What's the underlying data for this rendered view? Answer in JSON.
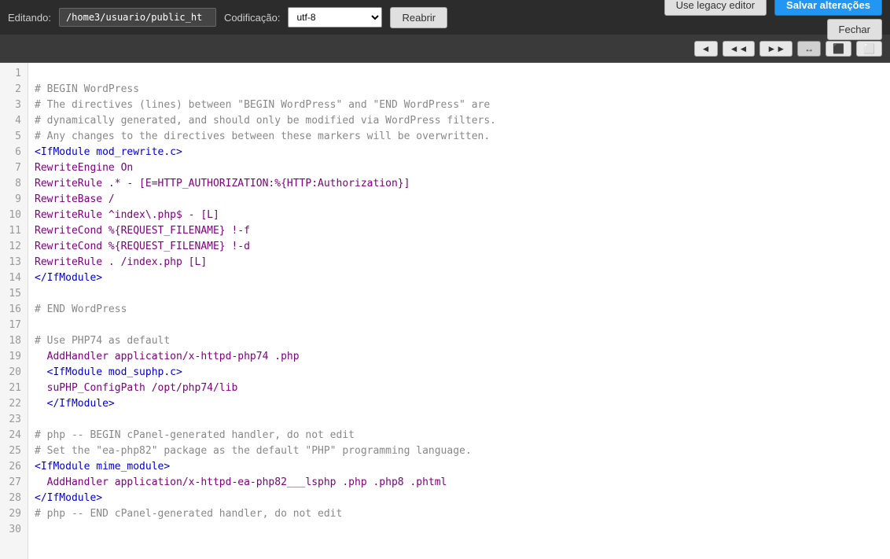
{
  "toolbar": {
    "editando_label": "Editando:",
    "filepath": "/home3/usuario/public_ht",
    "codificacao_label": "Codificação:",
    "encoding": "utf-8",
    "reabrir_label": "Reabrir",
    "legacy_label": "Use legacy editor",
    "salvar_label": "Salvar alterações",
    "fechar_label": "Fechar"
  },
  "toolbar2": {
    "btn_arrow": "↔"
  },
  "code": {
    "lines": [
      {
        "num": 1,
        "text": "",
        "class": "empty"
      },
      {
        "num": 2,
        "text": "# BEGIN WordPress",
        "class": "c-comment"
      },
      {
        "num": 3,
        "text": "# The directives (lines) between \"BEGIN WordPress\" and \"END WordPress\" are",
        "class": "c-comment"
      },
      {
        "num": 4,
        "text": "# dynamically generated, and should only be modified via WordPress filters.",
        "class": "c-comment"
      },
      {
        "num": 5,
        "text": "# Any changes to the directives between these markers will be overwritten.",
        "class": "c-comment"
      },
      {
        "num": 6,
        "text": "<IfModule mod_rewrite.c>",
        "class": "c-tag"
      },
      {
        "num": 7,
        "text": "RewriteEngine On",
        "class": "c-directive"
      },
      {
        "num": 8,
        "text": "RewriteRule .* - [E=HTTP_AUTHORIZATION:%{HTTP:Authorization}]",
        "class": "c-directive"
      },
      {
        "num": 9,
        "text": "RewriteBase /",
        "class": "c-directive"
      },
      {
        "num": 10,
        "text": "RewriteRule ^index\\.php$ - [L]",
        "class": "c-directive"
      },
      {
        "num": 11,
        "text": "RewriteCond %{REQUEST_FILENAME} !-f",
        "class": "c-directive"
      },
      {
        "num": 12,
        "text": "RewriteCond %{REQUEST_FILENAME} !-d",
        "class": "c-directive"
      },
      {
        "num": 13,
        "text": "RewriteRule . /index.php [L]",
        "class": "c-directive"
      },
      {
        "num": 14,
        "text": "</IfModule>",
        "class": "c-tag"
      },
      {
        "num": 15,
        "text": "",
        "class": "empty"
      },
      {
        "num": 16,
        "text": "# END WordPress",
        "class": "c-comment"
      },
      {
        "num": 17,
        "text": "",
        "class": "empty"
      },
      {
        "num": 18,
        "text": "# Use PHP74 as default",
        "class": "c-comment"
      },
      {
        "num": 19,
        "text": "  AddHandler application/x-httpd-php74 .php",
        "class": "c-directive"
      },
      {
        "num": 20,
        "text": "  <IfModule mod_suphp.c>",
        "class": "c-tag"
      },
      {
        "num": 21,
        "text": "  suPHP_ConfigPath /opt/php74/lib",
        "class": "c-directive"
      },
      {
        "num": 22,
        "text": "  </IfModule>",
        "class": "c-tag"
      },
      {
        "num": 23,
        "text": "",
        "class": "empty"
      },
      {
        "num": 24,
        "text": "# php -- BEGIN cPanel-generated handler, do not edit",
        "class": "c-comment"
      },
      {
        "num": 25,
        "text": "# Set the \"ea-php82\" package as the default \"PHP\" programming language.",
        "class": "c-comment"
      },
      {
        "num": 26,
        "text": "<IfModule mime_module>",
        "class": "c-tag"
      },
      {
        "num": 27,
        "text": "  AddHandler application/x-httpd-ea-php82___lsphp .php .php8 .phtml",
        "class": "c-directive"
      },
      {
        "num": 28,
        "text": "</IfModule>",
        "class": "c-tag"
      },
      {
        "num": 29,
        "text": "# php -- END cPanel-generated handler, do not edit",
        "class": "c-comment"
      },
      {
        "num": 30,
        "text": "",
        "class": "empty"
      }
    ]
  }
}
